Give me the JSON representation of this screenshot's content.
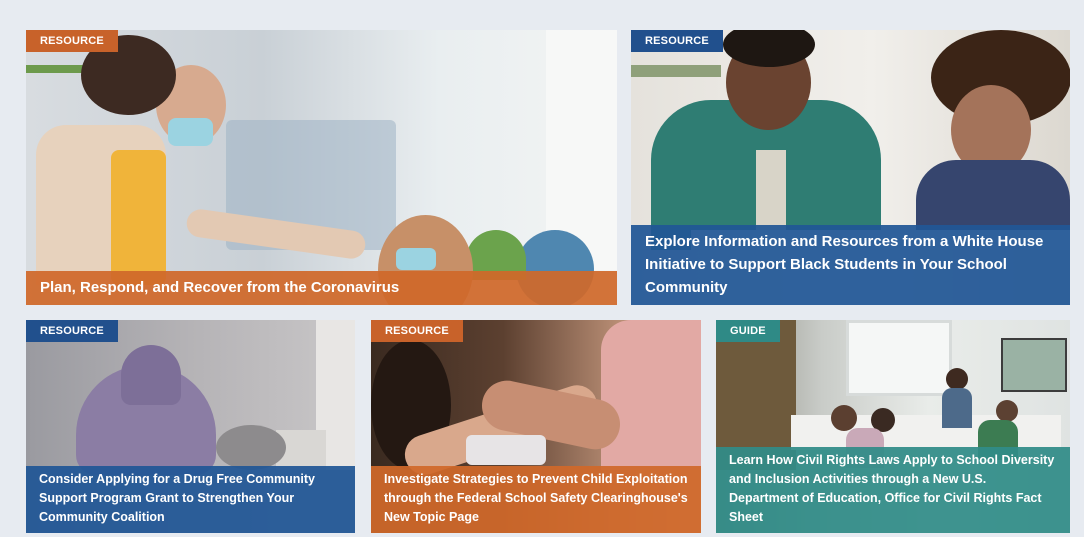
{
  "cards": [
    {
      "tag": "RESOURCE",
      "title": "Plan, Respond, and Recover from the Coronavirus",
      "image": "teacher-elbow-bump-with-student-masks"
    },
    {
      "tag": "RESOURCE",
      "title": "Explore Information and Resources from a White House Initiative to Support Black Students in Your School Community",
      "image": "mentor-and-student-studying"
    },
    {
      "tag": "RESOURCE",
      "title": "Consider Applying for a Drug Free Community Support Program Grant to Strengthen Your Community Coalition",
      "image": "hooded-teen-sitting-alone"
    },
    {
      "tag": "RESOURCE",
      "title": "Investigate Strategies to Prevent Child Exploitation through the Federal School Safety Clearinghouse's New Topic Page",
      "image": "comforting-hands-holding"
    },
    {
      "tag": "GUIDE",
      "title": "Learn How Civil Rights Laws Apply to School Diversity and Inclusion Activities through a New U.S. Department of Education, Office for Civil Rights Fact Sheet",
      "image": "diverse-classroom-with-teacher"
    }
  ]
}
